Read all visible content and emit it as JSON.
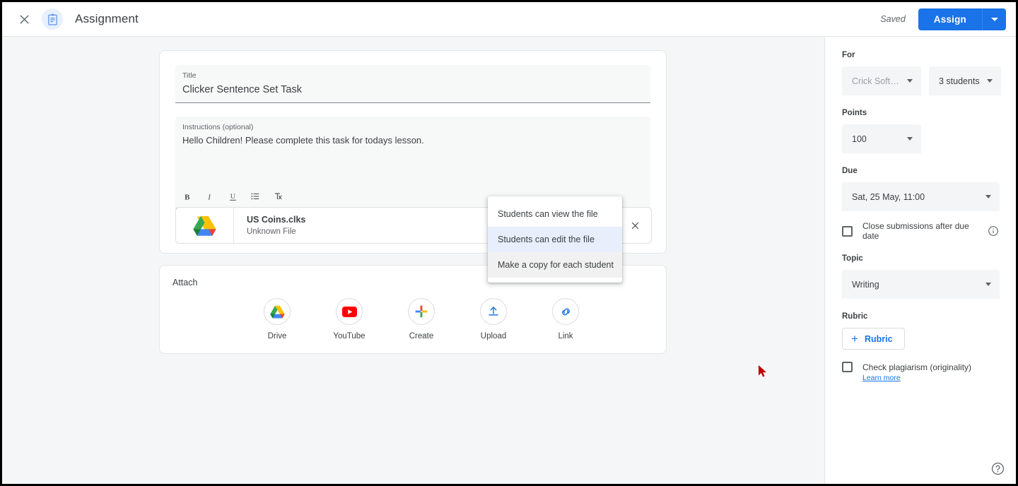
{
  "topbar": {
    "close_icon": "close-icon",
    "assignment_icon": "clipboard-icon",
    "title": "Assignment",
    "saved_label": "Saved",
    "assign_label": "Assign",
    "assign_caret_icon": "chevron-down-icon"
  },
  "details": {
    "title_field": {
      "label": "Title",
      "value": "Clicker Sentence Set Task"
    },
    "instructions_field": {
      "label": "Instructions (optional)",
      "value": "Hello Children! Please complete this task for todays lesson."
    },
    "toolbar": [
      {
        "name": "bold-icon",
        "glyph": "B"
      },
      {
        "name": "italic-icon",
        "glyph": "I"
      },
      {
        "name": "underline-icon",
        "glyph": "U"
      },
      {
        "name": "bulleted-list-icon",
        "glyph": "☰"
      },
      {
        "name": "clear-formatting-icon",
        "glyph": "T̸"
      }
    ],
    "attachment": {
      "icon": "google-drive-icon",
      "name": "US Coins.clks",
      "subtitle": "Unknown File",
      "remove_icon": "close-icon"
    }
  },
  "permission_menu": {
    "items": [
      {
        "label": "Students can view the file",
        "state": "normal"
      },
      {
        "label": "Students can edit the file",
        "state": "selected"
      },
      {
        "label": "Make a copy for each student",
        "state": "hovered"
      }
    ]
  },
  "attach_section": {
    "title": "Attach",
    "options": [
      {
        "label": "Drive",
        "icon": "google-drive-icon"
      },
      {
        "label": "YouTube",
        "icon": "youtube-icon"
      },
      {
        "label": "Create",
        "icon": "google-plus-create-icon"
      },
      {
        "label": "Upload",
        "icon": "upload-icon"
      },
      {
        "label": "Link",
        "icon": "link-icon"
      }
    ]
  },
  "sidebar": {
    "for": {
      "label": "For",
      "class_value": "Crick Softwa…",
      "students_value": "3 students"
    },
    "points": {
      "label": "Points",
      "value": "100"
    },
    "due": {
      "label": "Due",
      "value": "Sat, 25 May, 11:00",
      "close_submissions_label": "Close submissions after due date",
      "info_icon": "info-icon"
    },
    "topic": {
      "label": "Topic",
      "value": "Writing"
    },
    "rubric": {
      "label": "Rubric",
      "button_label": "Rubric",
      "plus_icon": "plus-icon"
    },
    "plagiarism": {
      "label": "Check plagiarism (originality)",
      "learn_more": "Learn more"
    }
  },
  "help": {
    "icon": "help-circle-icon"
  },
  "colors": {
    "accent_blue": "#1a73e8",
    "page_bg": "#f5f6f7",
    "field_bg": "#f4f5f6",
    "selected_menu_bg": "#e8eefb",
    "hover_menu_bg": "#f1f1f1",
    "cursor_red": "#c00000"
  }
}
